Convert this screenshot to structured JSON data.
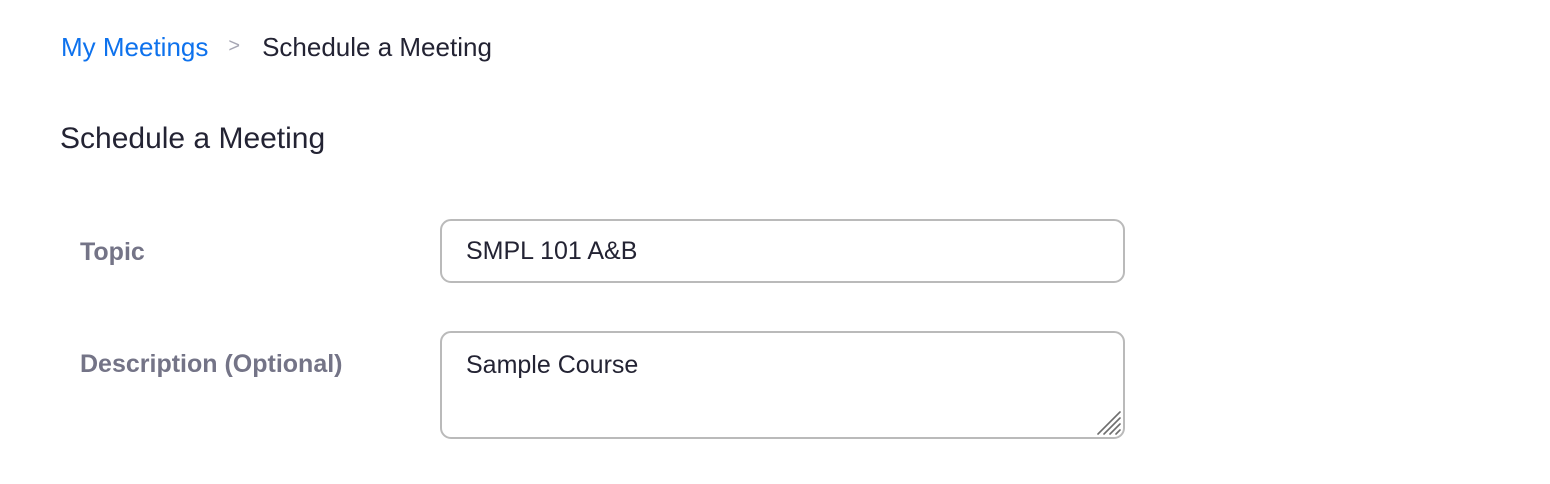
{
  "breadcrumb": {
    "parent_label": "My Meetings",
    "separator": ">",
    "current_label": "Schedule a Meeting"
  },
  "page": {
    "title": "Schedule a Meeting"
  },
  "form": {
    "topic": {
      "label": "Topic",
      "value": "SMPL 101 A&B"
    },
    "description": {
      "label": "Description (Optional)",
      "value": "Sample Course"
    }
  },
  "colors": {
    "link": "#0e72ed",
    "text": "#232333",
    "label": "#747487",
    "border": "#bababa"
  },
  "icons": {
    "resize_handle": "textarea-resize-grip-icon"
  }
}
